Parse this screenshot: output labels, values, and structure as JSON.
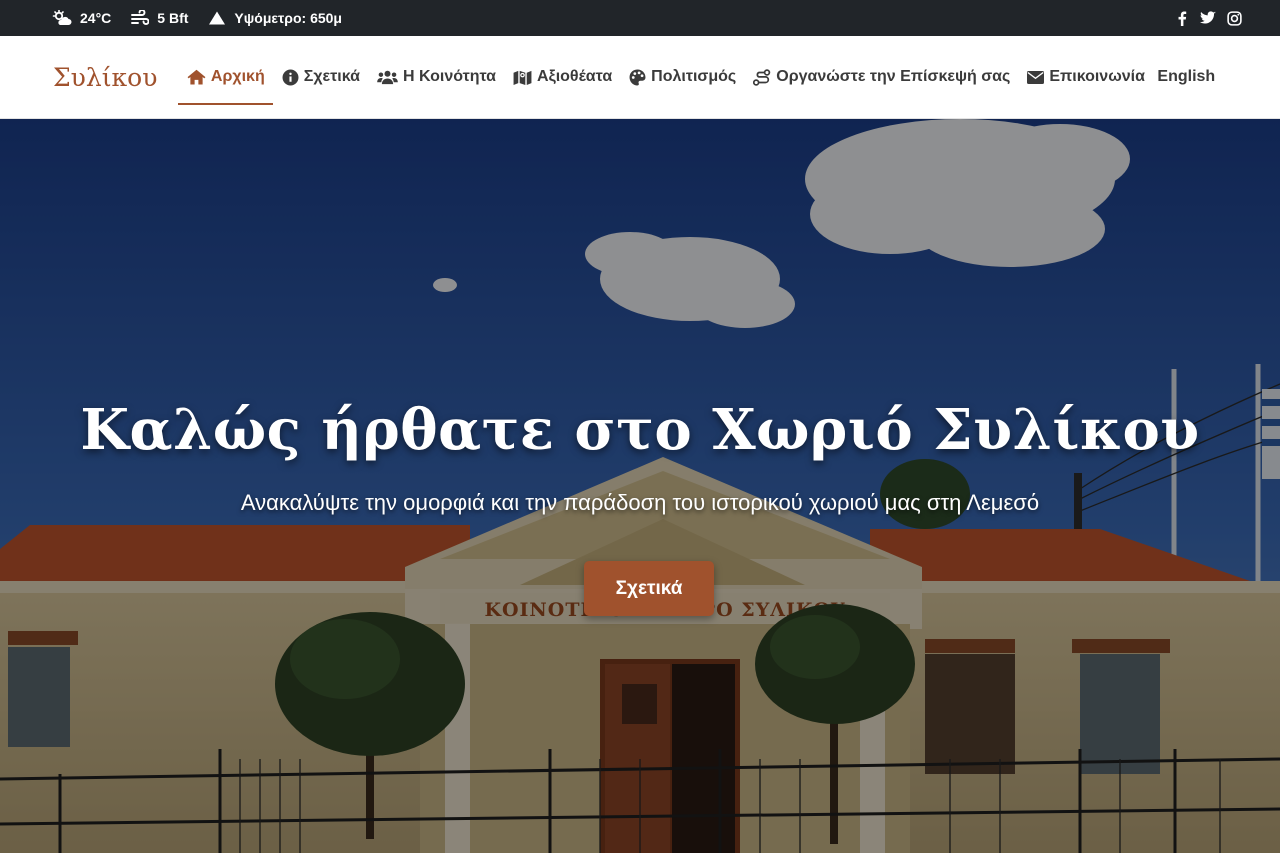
{
  "topbar": {
    "weather": "24°C",
    "wind": "5 Bft",
    "altitude": "Υψόμετρο: 650μ",
    "social_icons": [
      "facebook-icon",
      "twitter-icon",
      "instagram-icon"
    ]
  },
  "navbar": {
    "brand": "Συλίκου",
    "items": [
      {
        "label": "Αρχική",
        "icon": "home-icon",
        "active": true
      },
      {
        "label": "Σχετικά",
        "icon": "info-circle-icon",
        "active": false
      },
      {
        "label": "Η Κοινότητα",
        "icon": "users-icon",
        "active": false
      },
      {
        "label": "Αξιοθέατα",
        "icon": "map-icon",
        "active": false
      },
      {
        "label": "Πολιτισμός",
        "icon": "palette-icon",
        "active": false
      },
      {
        "label": "Οργανώστε την Επίσκεψή σας",
        "icon": "route-icon",
        "active": false
      },
      {
        "label": "Επικοινωνία",
        "icon": "envelope-icon",
        "active": false
      }
    ],
    "language": "English"
  },
  "hero": {
    "title": "Καλώς ήρθατε στο Χωριό Συλίκου",
    "subtitle": "Ανακαλύψτε την ομορφιά και την παράδοση του ιστορικού χωριού μας στη Λεμεσό",
    "button_label": "Σχετικά",
    "building_sign": "ΚΟΙΝΟΤΙΚΟ ΜΕΓΑΡΟ ΣΥΛΙΚΟΥ"
  },
  "colors": {
    "accent": "#a0522d",
    "topbar_bg": "#212529",
    "nav_text": "#3b3b3b"
  }
}
